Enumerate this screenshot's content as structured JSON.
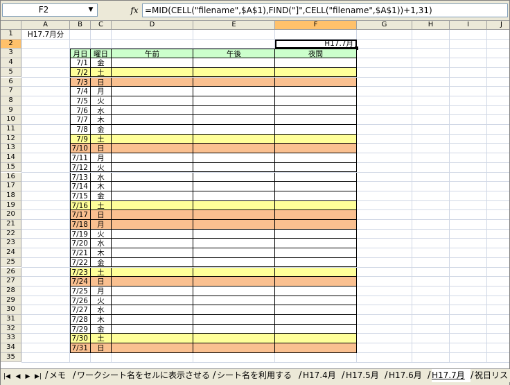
{
  "formula_bar": {
    "name_box": "F2",
    "fx_label": "fx",
    "formula": "=MID(CELL(\"filename\",$A$1),FIND(\"]\",CELL(\"filename\",$A$1))+1,31)"
  },
  "columns": [
    "A",
    "B",
    "C",
    "D",
    "E",
    "F",
    "G",
    "H",
    "I",
    "J"
  ],
  "selected_column": "F",
  "selected_row": 2,
  "rows": [
    "1",
    "2",
    "3",
    "4",
    "5",
    "6",
    "7",
    "8",
    "9",
    "10",
    "11",
    "12",
    "13",
    "14",
    "15",
    "16",
    "17",
    "18",
    "19",
    "20",
    "21",
    "22",
    "23",
    "24",
    "25",
    "26",
    "27",
    "28",
    "29",
    "30",
    "31",
    "32",
    "33",
    "34",
    "35"
  ],
  "cells": {
    "a1": "H17.7月分",
    "f2": "H17.7月"
  },
  "table": {
    "headers": {
      "month_day": "月日",
      "weekday": "曜日",
      "morning": "午前",
      "afternoon": "午後",
      "night": "夜間"
    },
    "days": [
      {
        "date": "7/1",
        "wd": "金",
        "type": "weekday"
      },
      {
        "date": "7/2",
        "wd": "土",
        "type": "sat"
      },
      {
        "date": "7/3",
        "wd": "日",
        "type": "sun"
      },
      {
        "date": "7/4",
        "wd": "月",
        "type": "weekday"
      },
      {
        "date": "7/5",
        "wd": "火",
        "type": "weekday"
      },
      {
        "date": "7/6",
        "wd": "水",
        "type": "weekday"
      },
      {
        "date": "7/7",
        "wd": "木",
        "type": "weekday"
      },
      {
        "date": "7/8",
        "wd": "金",
        "type": "weekday"
      },
      {
        "date": "7/9",
        "wd": "土",
        "type": "sat"
      },
      {
        "date": "7/10",
        "wd": "日",
        "type": "sun"
      },
      {
        "date": "7/11",
        "wd": "月",
        "type": "weekday"
      },
      {
        "date": "7/12",
        "wd": "火",
        "type": "weekday"
      },
      {
        "date": "7/13",
        "wd": "水",
        "type": "weekday"
      },
      {
        "date": "7/14",
        "wd": "木",
        "type": "weekday"
      },
      {
        "date": "7/15",
        "wd": "金",
        "type": "weekday"
      },
      {
        "date": "7/16",
        "wd": "土",
        "type": "sat"
      },
      {
        "date": "7/17",
        "wd": "日",
        "type": "sun"
      },
      {
        "date": "7/18",
        "wd": "月",
        "type": "holiday"
      },
      {
        "date": "7/19",
        "wd": "火",
        "type": "weekday"
      },
      {
        "date": "7/20",
        "wd": "水",
        "type": "weekday"
      },
      {
        "date": "7/21",
        "wd": "木",
        "type": "weekday"
      },
      {
        "date": "7/22",
        "wd": "金",
        "type": "weekday"
      },
      {
        "date": "7/23",
        "wd": "土",
        "type": "sat"
      },
      {
        "date": "7/24",
        "wd": "日",
        "type": "sun"
      },
      {
        "date": "7/25",
        "wd": "月",
        "type": "weekday"
      },
      {
        "date": "7/26",
        "wd": "火",
        "type": "weekday"
      },
      {
        "date": "7/27",
        "wd": "水",
        "type": "weekday"
      },
      {
        "date": "7/28",
        "wd": "木",
        "type": "weekday"
      },
      {
        "date": "7/29",
        "wd": "金",
        "type": "weekday"
      },
      {
        "date": "7/30",
        "wd": "土",
        "type": "sat"
      },
      {
        "date": "7/31",
        "wd": "日",
        "type": "sun"
      }
    ]
  },
  "colors": {
    "header_fill": "#ccffcc",
    "saturday_fill": "#ffff99",
    "sunday_fill": "#fac090",
    "selection_highlight": "#ffc16b"
  },
  "sheet_tabs": [
    {
      "label": "メモ",
      "active": false
    },
    {
      "label": "ワークシート名をセルに表示させる",
      "active": false
    },
    {
      "label": "シート名を利用する",
      "active": false
    },
    {
      "label": "H17.4月",
      "active": false
    },
    {
      "label": "H17.5月",
      "active": false
    },
    {
      "label": "H17.6月",
      "active": false
    },
    {
      "label": "H17.7月",
      "active": true
    },
    {
      "label": "祝日リスト",
      "active": false
    }
  ],
  "tab_nav_icons": [
    "first-sheet-icon",
    "prev-sheet-icon",
    "next-sheet-icon",
    "last-sheet-icon"
  ]
}
